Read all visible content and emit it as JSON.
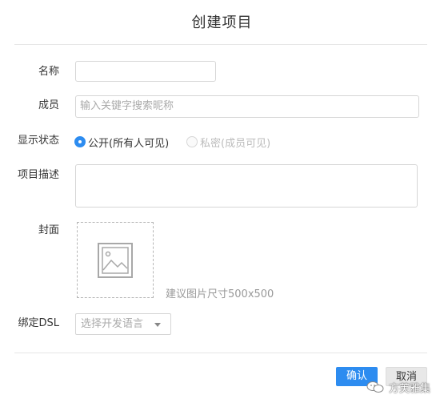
{
  "dialog": {
    "title": "创建项目",
    "fields": {
      "name_label": "名称",
      "name_value": "",
      "members_label": "成员",
      "members_placeholder": "输入关键字搜索昵称",
      "visibility_label": "显示状态",
      "visibility_options": [
        "公开(所有人可见)",
        "私密(成员可见)"
      ],
      "visibility_selected": "公开(所有人可见)",
      "description_label": "项目描述",
      "description_value": "",
      "cover_label": "封面",
      "cover_hint": "建议图片尺寸500x500",
      "dsl_label": "绑定DSL",
      "dsl_placeholder": "选择开发语言"
    },
    "buttons": {
      "confirm": "确认",
      "cancel": "取消"
    }
  },
  "watermark": {
    "text": "方芙雅集"
  },
  "colors": {
    "primary": "#2d8cf0",
    "border": "#d6d6d6",
    "divider": "#e6e6e6"
  }
}
